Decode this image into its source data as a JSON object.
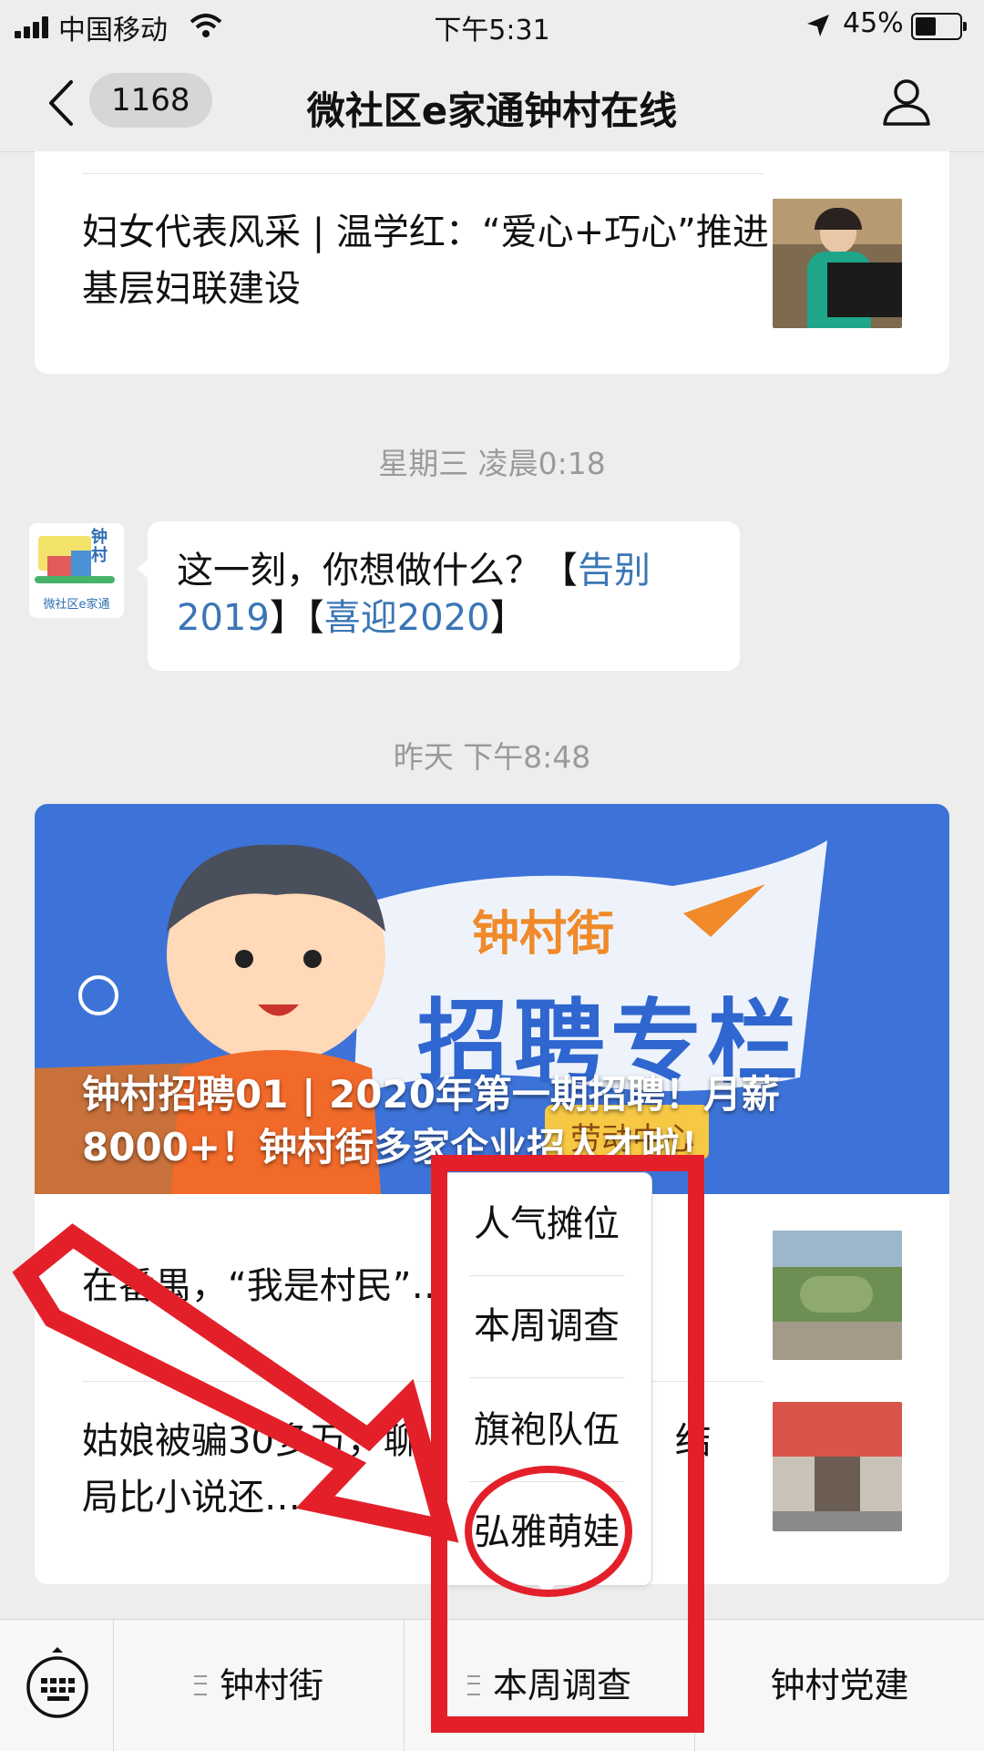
{
  "status_bar": {
    "carrier": "中国移动",
    "time": "下午5:31",
    "battery": "45%"
  },
  "nav": {
    "back_count": "1168",
    "title": "微社区e家通钟村在线",
    "profile_icon": "person-icon",
    "back_icon": "chevron-left-icon"
  },
  "feed": {
    "article_top": {
      "title": "妇女代表风采 | 温学红：“爱心+巧心”推进基层妇联建设"
    },
    "timestamp_1": "星期三 凌晨0:18",
    "message": {
      "avatar_logo_text": "钟村",
      "avatar_caption": "微社区e家通",
      "text_prefix": "这一刻，你想做什么？【",
      "link_1": "告别2019",
      "text_middle": "】【",
      "link_2": "喜迎2020",
      "text_suffix": "】"
    },
    "timestamp_2": "昨天 下午8:48",
    "banner": {
      "street": "钟村街",
      "big_title": "招聘专栏",
      "label": "劳动中心",
      "headline": "钟村招聘01 | 2020年第一期招聘！月薪8000+！钟村街多家企业招人才啦！"
    },
    "list_items": [
      {
        "title": "在番禺，“我是村民”……！"
      },
      {
        "title": "姑娘被骗30多万，聊……竟爱上她！结局比小说还……"
      }
    ]
  },
  "popup_menu": {
    "items": [
      "人气摊位",
      "本周调查",
      "旗袍队伍",
      "弘雅萌娃"
    ]
  },
  "bottom_menu": {
    "keyboard_icon": "keyboard-icon",
    "items": [
      "钟村街",
      "本周调查",
      "钟村党建"
    ]
  },
  "colors": {
    "background": "#ededed",
    "link": "#3a76b5",
    "annotation_red": "#e3202a",
    "banner_blue": "#3d73d8"
  }
}
